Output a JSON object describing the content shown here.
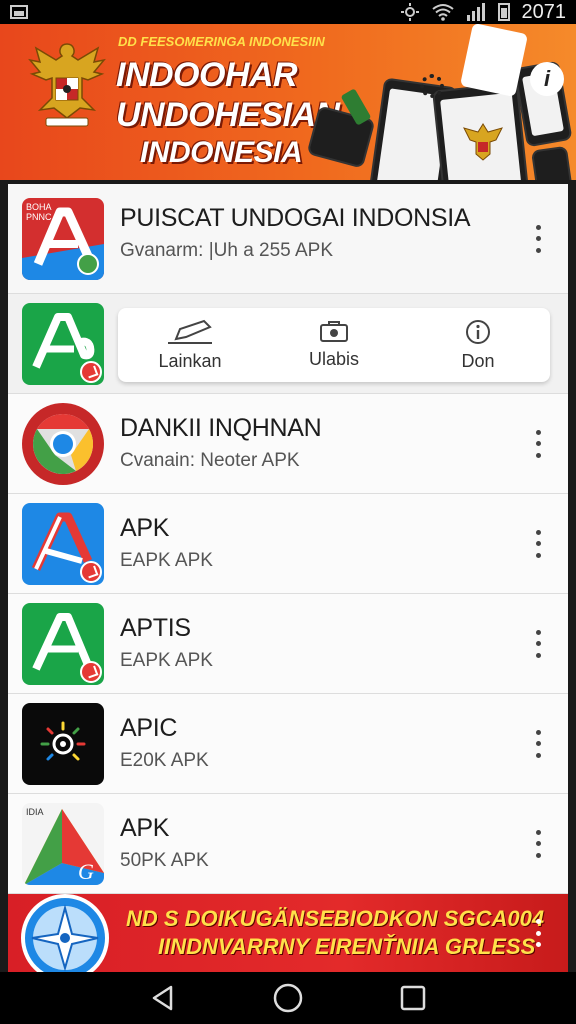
{
  "status_bar": {
    "time": "2071"
  },
  "banner": {
    "small_title": "DD FEESOMERINGA INDONESIIN",
    "line1": "INDOOHAR",
    "line2": "UNDOHESIAN",
    "line3": "INDONESIA"
  },
  "first_item": {
    "icon_text": "BOHA PNNC",
    "title": "PUISCAT UNDOGAI INDONSIA",
    "subtitle": "Gvanarm: |Uh a 255 APK"
  },
  "action_card": {
    "actions": [
      {
        "label": "Lainkan",
        "icon": "edit-icon"
      },
      {
        "label": "Ulabis",
        "icon": "backup-icon"
      },
      {
        "label": "Don",
        "icon": "info-icon"
      }
    ]
  },
  "apps": [
    {
      "title": "DANKII INQHNAN",
      "subtitle": "Cvanain: Neoter APK",
      "icon": "chrome-icon"
    },
    {
      "title": "APK",
      "subtitle": "EAPK APK",
      "icon": "apk-blue-icon"
    },
    {
      "title": "APTIS",
      "subtitle": "EAPK APK",
      "icon": "apk-green-icon"
    },
    {
      "title": "APIC",
      "subtitle": "E20K APK",
      "icon": "sun-icon"
    },
    {
      "title": "APK",
      "subtitle": "50PK APK",
      "icon": "triangle-colorful-icon",
      "icon_text": "IDIA"
    }
  ],
  "footer_banner": {
    "line1": "ND S DOIKUGÄNSEBIODKON SGCA004",
    "line2": "IINDNVARRNY EIRENŤNIIA GRLESS"
  },
  "colors": {
    "banner_orange": "#e8471c",
    "footer_red": "#d81f26",
    "accent_green": "#1aa548",
    "accent_red": "#d32f2f"
  }
}
